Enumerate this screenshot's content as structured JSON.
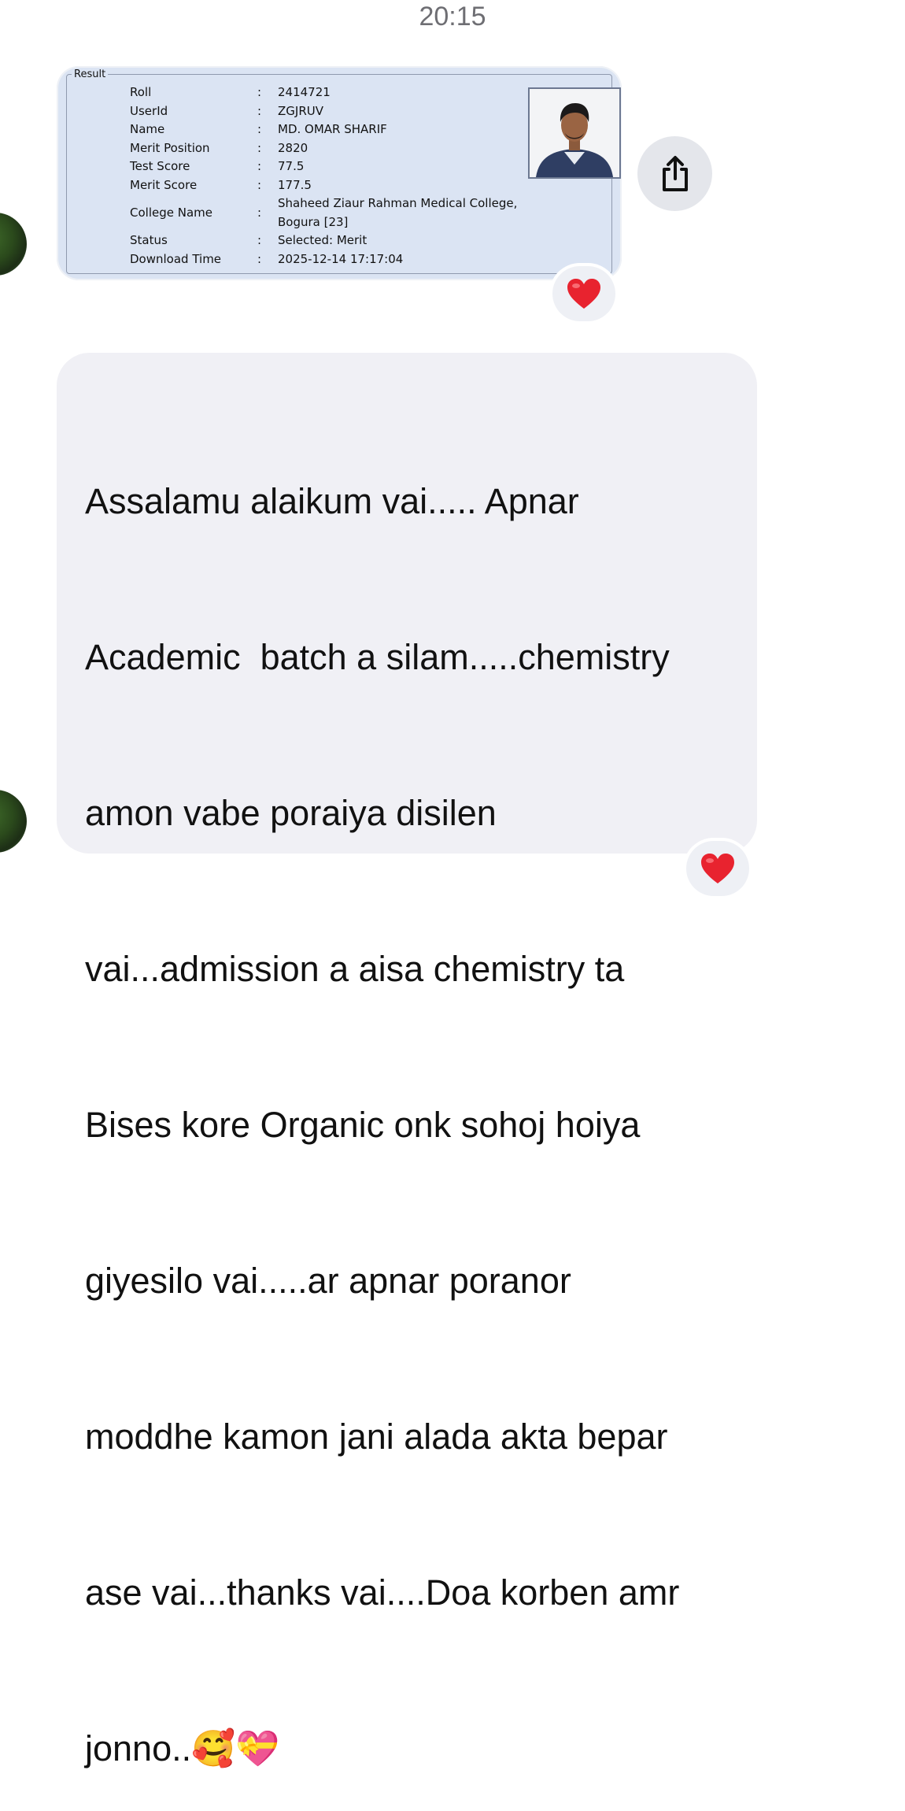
{
  "header": {
    "time": "20:15"
  },
  "image_message": {
    "legend": "Result",
    "rows": [
      {
        "label": "Roll",
        "value": "2414721"
      },
      {
        "label": "UserId",
        "value": "ZGJRUV"
      },
      {
        "label": "Name",
        "value": "MD. OMAR SHARIF"
      },
      {
        "label": "Merit Position",
        "value": "2820"
      },
      {
        "label": "Test Score",
        "value": "77.5"
      },
      {
        "label": "Merit Score",
        "value": "177.5"
      },
      {
        "label": "College Name",
        "value": "Shaheed Ziaur Rahman Medical College,",
        "value2": "Bogura [23]"
      },
      {
        "label": "Status",
        "value": "Selected: Merit"
      },
      {
        "label": "Download Time",
        "value": "2025-12-14 17:17:04"
      }
    ],
    "colon": ":",
    "reaction": "❤️"
  },
  "text_message": {
    "lines": [
      "Assalamu alaikum vai..... Apnar",
      "Academic  batch a silam.....chemistry",
      "amon vabe poraiya disilen",
      "vai...admission a aisa chemistry ta",
      "Bises kore Organic onk sohoj hoiya",
      "giyesilo vai.....ar apnar poranor",
      "moddhe kamon jani alada akta bepar",
      "ase vai...thanks vai....Doa korben amr",
      "jonno..🥰💝"
    ],
    "reaction": "❤️"
  },
  "colors": {
    "bubble": "#f0f0f5",
    "image_bg": "#dbe4f3",
    "heart": "#e8232f"
  },
  "icons": [
    "share-icon",
    "heart-icon",
    "avatar"
  ]
}
